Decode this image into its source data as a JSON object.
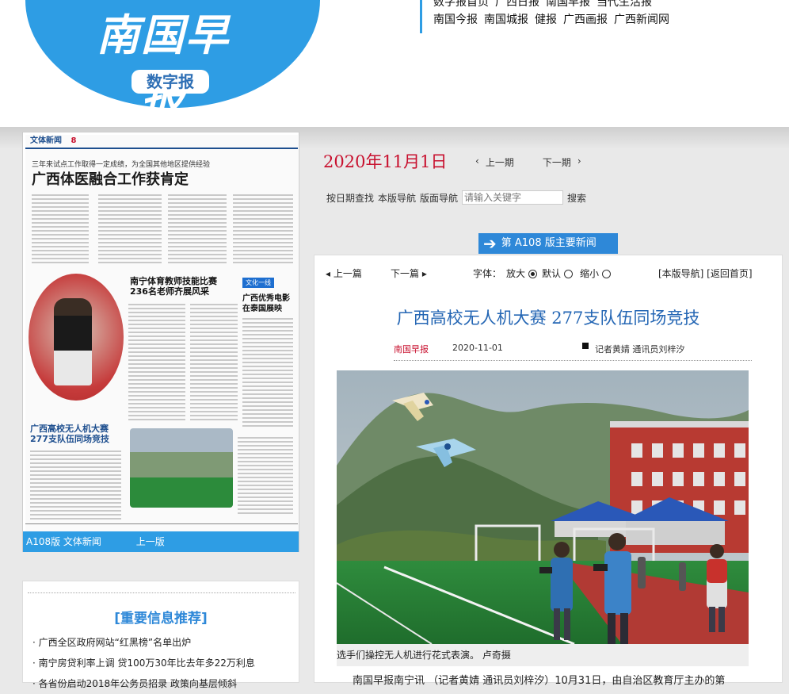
{
  "header": {
    "logo_title": "南国早报",
    "logo_badge": "数字报",
    "nav_row_1": [
      "数字报首页",
      "广西日报",
      "南国早报",
      "当代生活报"
    ],
    "nav_row_2": [
      "南国今报",
      "南国城报",
      "健报",
      "广西画报",
      "广西新闻网"
    ]
  },
  "paper_thumb": {
    "section": "文体新闻",
    "page_num": "8",
    "kicker": "三年来试点工作取得一定成绩，为全国其他地区提供经验",
    "headline": "广西体医融合工作获肯定",
    "sub_head_1": "南宁体育教师技能比赛\n236名老师齐展风采",
    "tag_1": "文化一线",
    "sub_head_2": "广西优秀电影\n在泰国展映",
    "sub_head_3": "广西高校无人机大赛\n277支队伍同场竞技"
  },
  "paper_caption": {
    "page_label": "A108版 文体新闻",
    "prev_label": "上一版"
  },
  "recommend": {
    "title": "[重要信息推荐]",
    "items": [
      "广西全区政府网站“红黑榜”名单出炉",
      "南宁房贷利率上调 贷100万30年比去年多22万利息",
      "各省份启动2018年公务员招录 政策向基层倾斜"
    ]
  },
  "issue": {
    "date": "2020年11月1日",
    "prev_issue": "上一期",
    "next_issue": "下一期"
  },
  "search": {
    "by_date": "按日期查找",
    "page_nav": "本版导航",
    "layout_nav": "版面导航",
    "placeholder": "请输入关键字",
    "button": "搜索"
  },
  "section_banner": "第 A108 版主要新闻",
  "article": {
    "prev": "上一篇",
    "next": "下一篇",
    "font_label": "字体：",
    "font_large": "放大",
    "font_default": "默认",
    "font_small": "缩小",
    "links": "[本版导航] [返回首页]",
    "title": "广西高校无人机大赛 277支队伍同场竞技",
    "source": "南国早报",
    "date": "2020-11-01",
    "authors": "记者黄婧 通讯员刘梓汐",
    "photo_caption": "选手们操控无人机进行花式表演。 卢奇摄",
    "body_first_line": "南国早报南宁讯 （记者黄婧 通讯员刘梓汐）10月31日，由自治区教育厅主办的第"
  },
  "colors": {
    "brand_blue": "#2e9de4",
    "title_blue": "#2466b4",
    "date_red": "#c8102e"
  }
}
